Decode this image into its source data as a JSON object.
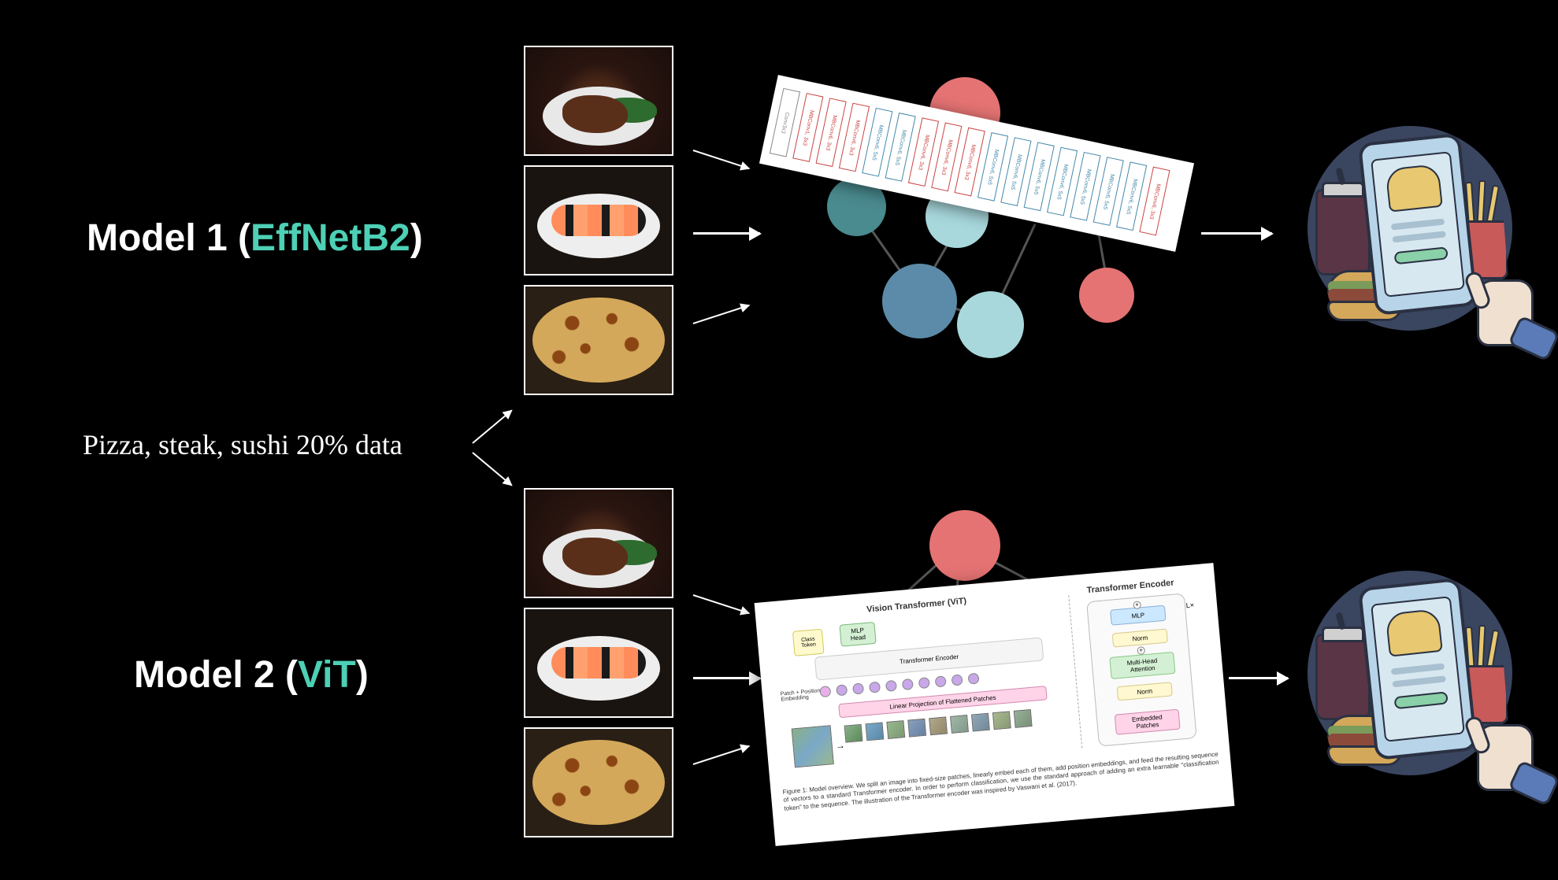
{
  "model1": {
    "prefix": "Model 1 (",
    "name": "EffNetB2",
    "suffix": ")"
  },
  "model2": {
    "prefix": "Model 2 (",
    "name": "ViT",
    "suffix": ")"
  },
  "data_label": "Pizza, steak, sushi 20% data",
  "colors": {
    "accent": "#4DD0B5",
    "node_red": "#E57373",
    "node_teal_dark": "#4A8B8F",
    "node_teal_light": "#A8D8DC",
    "node_yellow": "#F4D06F",
    "node_blue": "#5B8BA8"
  },
  "effnet_blocks": [
    "Conv3x3",
    "MBConv1, 3x3",
    "MBConv6, 3x3",
    "MBConv6, 3x3",
    "MBConv6, 5x5",
    "MBConv6, 5x5",
    "MBConv6, 3x3",
    "MBConv6, 3x3",
    "MBConv6, 3x3",
    "MBConv6, 5x5",
    "MBConv6, 5x5",
    "MBConv6, 5x5",
    "MBConv6, 5x5",
    "MBConv6, 5x5",
    "MBConv6, 5x5",
    "MBConv6, 5x5",
    "MBConv6, 3x3"
  ],
  "vit": {
    "title_left": "Vision Transformer (ViT)",
    "title_right": "Transformer Encoder",
    "mlp_head": "MLP\nHead",
    "class_token": "Class\nToken",
    "encoder": "Transformer Encoder",
    "patch_embed": "Patch + Position\nEmbedding",
    "linear_proj": "Linear Projection of Flattened Patches",
    "enc_mlp": "MLP",
    "enc_norm": "Norm",
    "enc_mha": "Multi-Head\nAttention",
    "enc_embed": "Embedded\nPatches",
    "caption": "Figure 1: Model overview. We split an image into fixed-size patches, linearly embed each of them, add position embeddings, and feed the resulting sequence of vectors to a standard Transformer encoder. In order to perform classification, we use the standard approach of adding an extra learnable \"classification token\" to the sequence. The illustration of the Transformer encoder was inspired by Vaswani et al. (2017)."
  }
}
